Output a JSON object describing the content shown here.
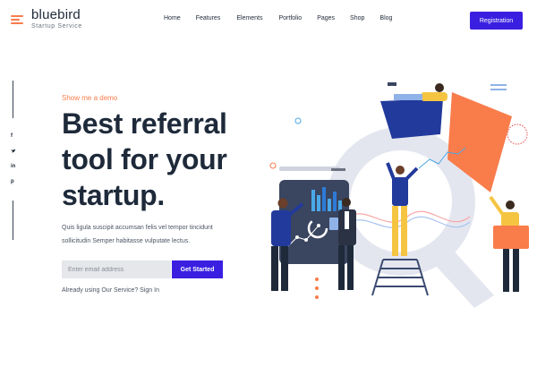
{
  "header": {
    "brand_name": "bluebird",
    "brand_tagline": "Startup Service",
    "nav": [
      "Home",
      "Features",
      "Elements",
      "Portfolio",
      "Pages",
      "Shop",
      "Blog"
    ],
    "cta_label": "Registration"
  },
  "social": [
    {
      "icon": "facebook-icon",
      "glyph": "f"
    },
    {
      "icon": "twitter-icon",
      "glyph": "•"
    },
    {
      "icon": "linkedin-icon",
      "glyph": "in"
    },
    {
      "icon": "pinterest-icon",
      "glyph": "p"
    }
  ],
  "hero": {
    "eyebrow": "Show me a demo",
    "headline": "Best referral tool for your startup.",
    "lead": "Quis ligula suscipit accumsan felis vel tempor tincidunt sollicitudin Semper habitasse vulputate lectus.",
    "email_placeholder": "Enter email address",
    "submit_label": "Get Started",
    "signin_prefix": "Already using Our Service?",
    "signin_link": "Sign In"
  },
  "colors": {
    "accent": "#3b1fe0",
    "orange": "#f97c4b",
    "navy": "#1e2a3a",
    "blue": "#2b3d8f",
    "yellow": "#f5c542"
  }
}
